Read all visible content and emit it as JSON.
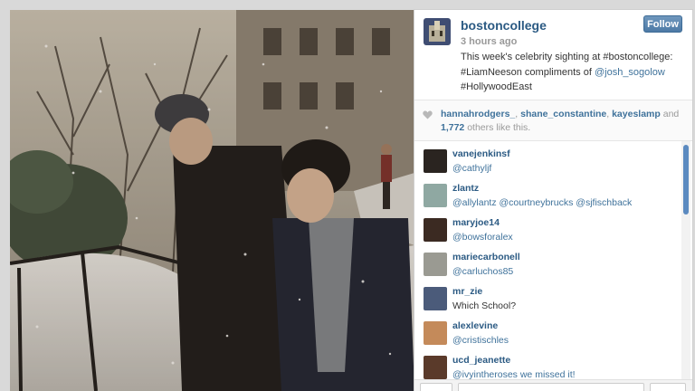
{
  "post": {
    "username": "bostoncollege",
    "time": "3 hours ago",
    "follow_label": "Follow",
    "caption": {
      "line1": "This week's celebrity sighting at #bostoncollege:",
      "line2_prefix": "#LiamNeeson compliments of ",
      "mention": "@josh_sogolow",
      "line3": "#HollywoodEast"
    }
  },
  "likes": {
    "user1": "hannahrodgers_",
    "sep1": ", ",
    "user2": "shane_constantine",
    "sep2": ", ",
    "user3": "kayeslamp",
    "and": " and",
    "count": "1,772",
    "suffix": " others like this."
  },
  "comments": [
    {
      "user": "vanejenkinsf",
      "text": "@cathyljf",
      "avatar_color": "#2a2420"
    },
    {
      "user": "zlantz",
      "text": "@allylantz @courtneybrucks @sjfischback",
      "avatar_color": "#8fa8a2"
    },
    {
      "user": "maryjoe14",
      "text": "@bowsforalex",
      "avatar_color": "#3b2a22"
    },
    {
      "user": "mariecarbonell",
      "text": "@carluchos85",
      "avatar_color": "#9a9a92"
    },
    {
      "user": "mr_zie",
      "text": "Which School?",
      "avatar_color": "#4b5b7a"
    },
    {
      "user": "alexlevine",
      "text": "@cristischles",
      "avatar_color": "#c48a5a"
    },
    {
      "user": "ucd_jeanette",
      "text": "@ivyintheroses we missed it!",
      "avatar_color": "#5a3a2a"
    }
  ],
  "colors": {
    "link": "#3f729b",
    "username": "#2b5a83",
    "follow_button": "#5585b0",
    "scroll_thumb": "#5b8ac0"
  }
}
